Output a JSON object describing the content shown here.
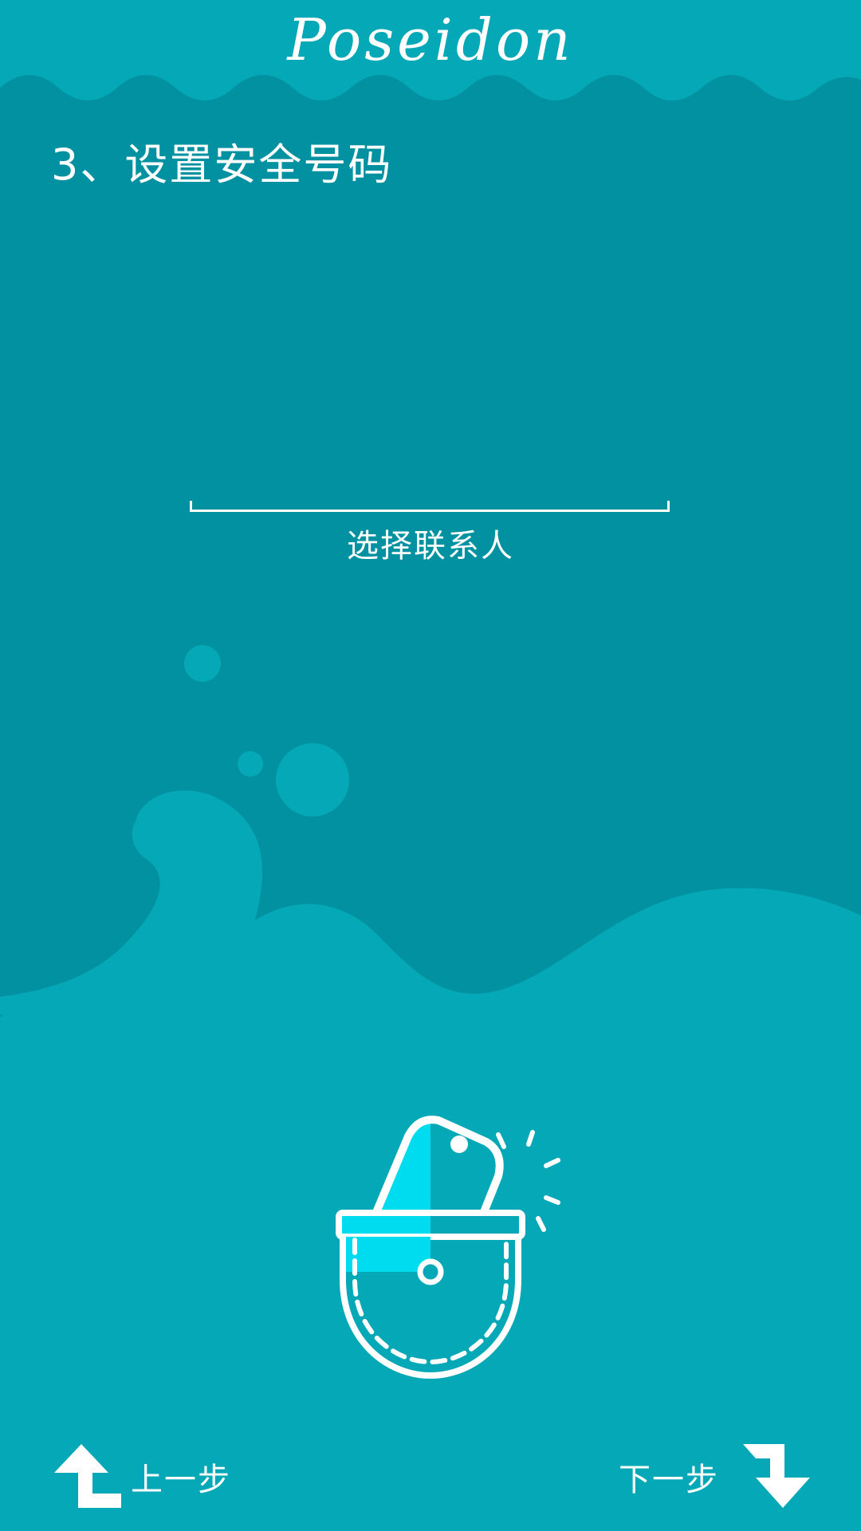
{
  "header": {
    "app_title": "Poseidon"
  },
  "step": {
    "title": "3、设置安全号码"
  },
  "contact": {
    "value": "",
    "select_label": "选择联系人"
  },
  "nav": {
    "prev_label": "上一步",
    "next_label": "下一步"
  },
  "icons": {
    "prev": "arrow-up-left-icon",
    "next": "arrow-down-right-icon",
    "illustration": "phone-in-pocket-icon"
  },
  "colors": {
    "header": "#02b6c4",
    "deep_water": "#0291a0",
    "foreground": "#04a8b6",
    "accent": "#00dcef"
  }
}
